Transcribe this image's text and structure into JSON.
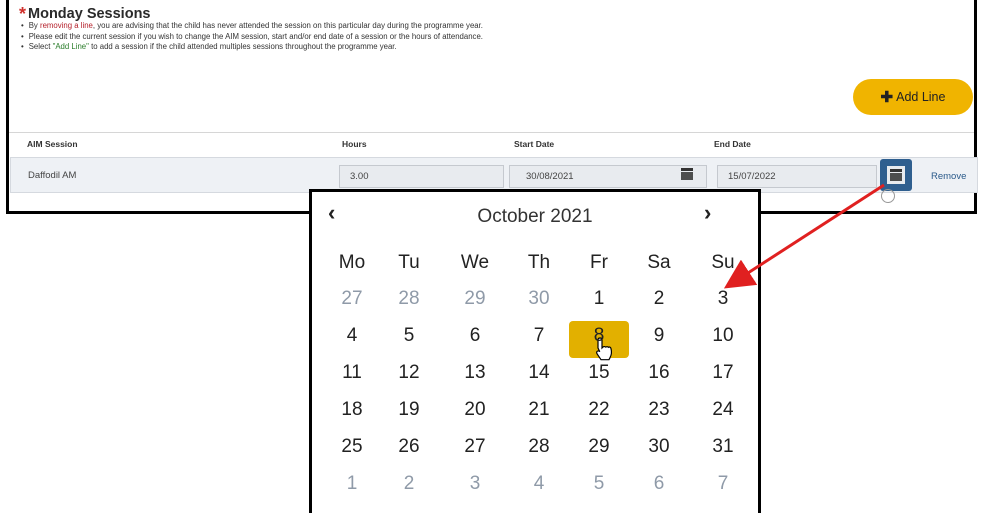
{
  "session": {
    "title": "Monday Sessions",
    "bullets": [
      {
        "pre": "By ",
        "link": "removing a line",
        "post": ", you are advising that the child has never attended the session on this particular day during the programme year."
      },
      {
        "pre": "Please edit the current session if you wish to change the AIM session, start and/or end date of a session or the hours of attendance.",
        "link": "",
        "post": ""
      },
      {
        "pre": "Select ",
        "link": "\"Add Line\"",
        "post": " to add a session if the child attended multiples sessions throughout the programme year."
      }
    ],
    "add_label": "Add Line",
    "add_icon": "plus-icon"
  },
  "table": {
    "headers": {
      "aim": "AIM Session",
      "hours": "Hours",
      "start": "Start Date",
      "end": "End Date"
    },
    "row": {
      "aim": "Daffodil AM",
      "hours": "3.00",
      "start": "30/08/2021",
      "end": "15/07/2022",
      "remove": "Remove"
    }
  },
  "calendar": {
    "prev": "‹",
    "next": "›",
    "month_label": "October 2021",
    "weekdays": [
      "Mo",
      "Tu",
      "We",
      "Th",
      "Fr",
      "Sa",
      "Su"
    ],
    "weeks": [
      [
        "27",
        "28",
        "29",
        "30",
        "1",
        "2",
        "3"
      ],
      [
        "4",
        "5",
        "6",
        "7",
        "8",
        "9",
        "10"
      ],
      [
        "11",
        "12",
        "13",
        "14",
        "15",
        "16",
        "17"
      ],
      [
        "18",
        "19",
        "20",
        "21",
        "22",
        "23",
        "24"
      ],
      [
        "25",
        "26",
        "27",
        "28",
        "29",
        "30",
        "31"
      ],
      [
        "1",
        "2",
        "3",
        "4",
        "5",
        "6",
        "7"
      ]
    ],
    "selected": "8",
    "accent": "#e2b000"
  },
  "colors": {
    "add_button": "#f0b400",
    "annotation_arrow": "#e02020",
    "highlight": "#2f5f8f"
  }
}
